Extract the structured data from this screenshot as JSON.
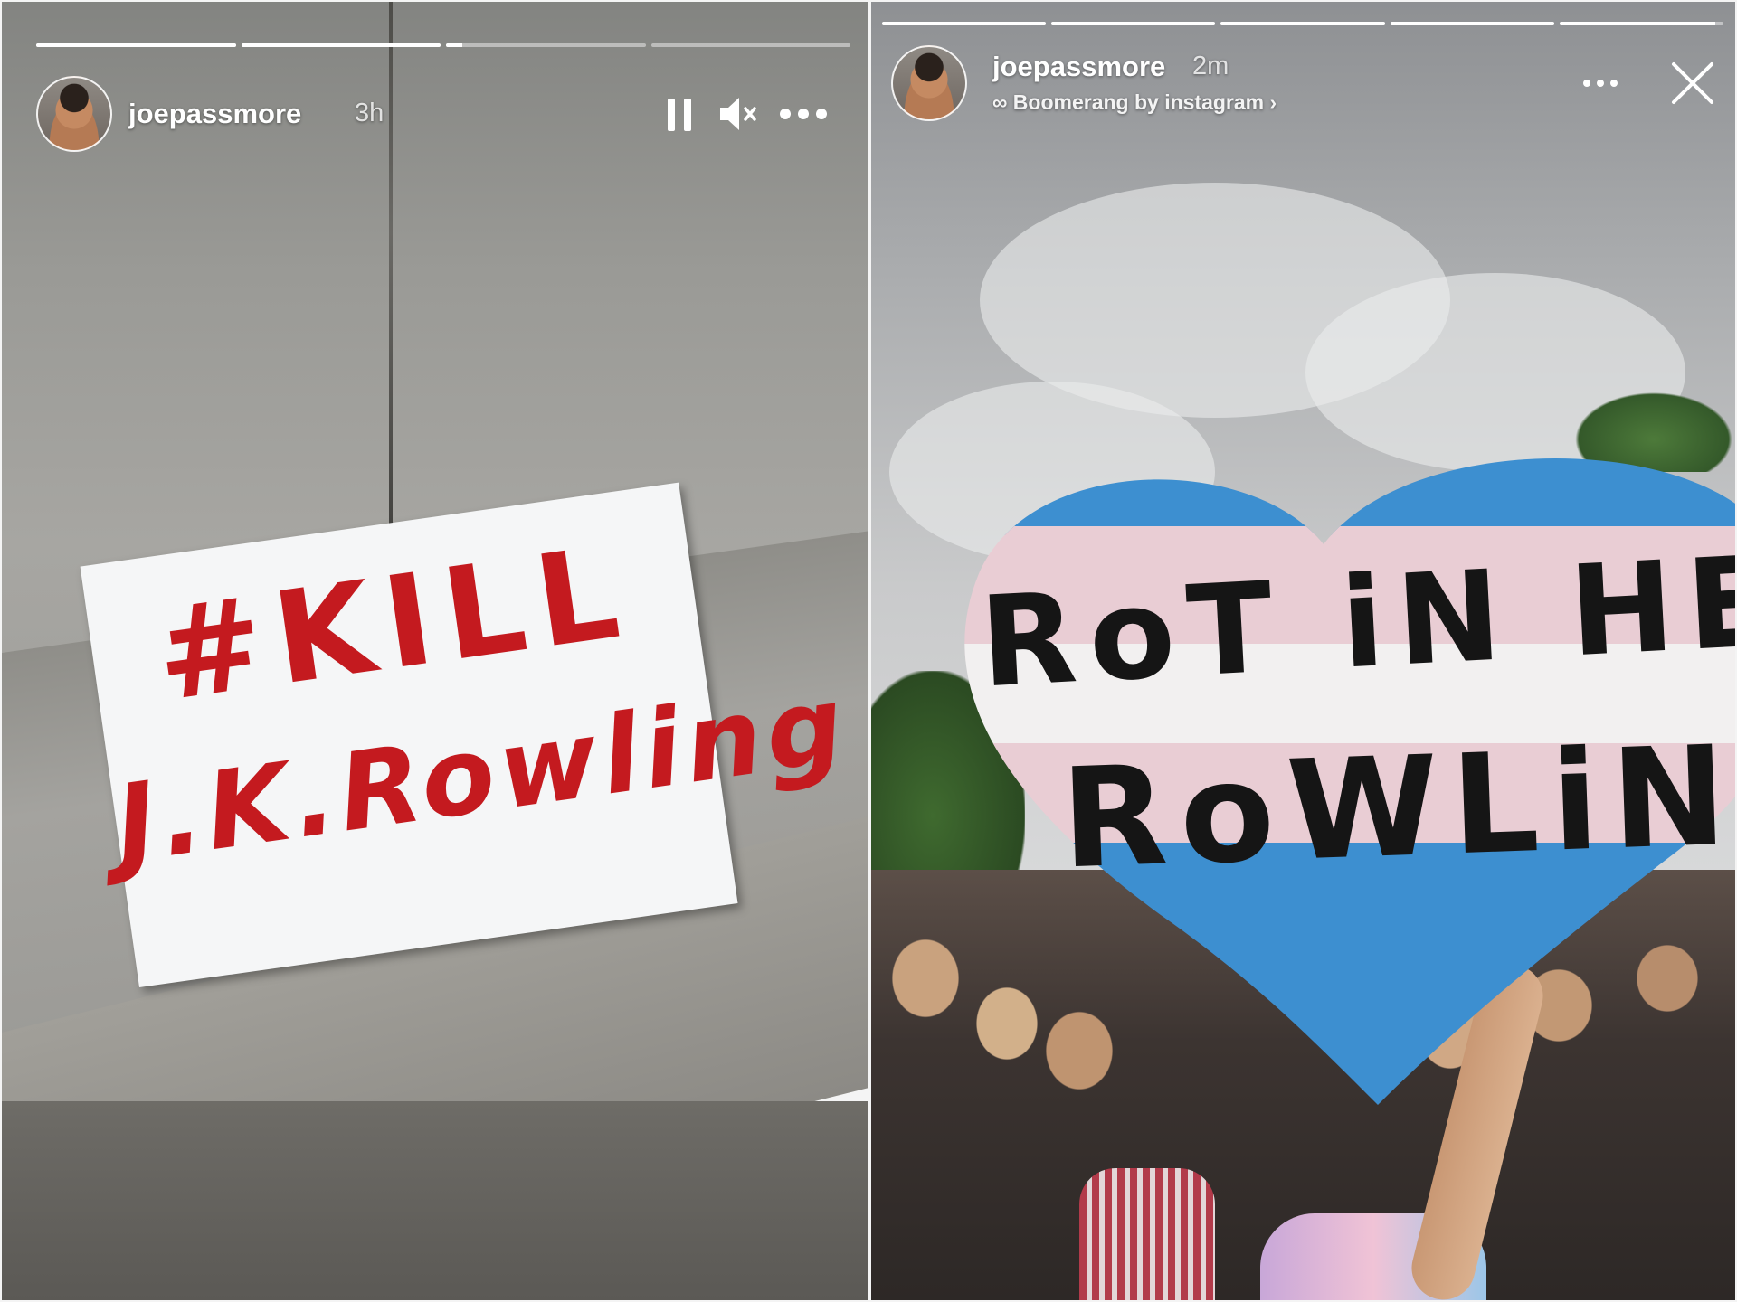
{
  "left_story": {
    "progress": [
      1.0,
      1.0,
      0.08,
      0.0
    ],
    "username": "joepassmore",
    "timestamp": "3h",
    "icons": [
      "pause-icon",
      "mute-icon",
      "more-icon"
    ],
    "sign_lines": [
      "#KILL",
      "J.K.Rowling"
    ],
    "sign_color": "#c41a1f"
  },
  "right_story": {
    "progress": [
      1.0,
      1.0,
      1.0,
      1.0,
      0.95
    ],
    "username": "joepassmore",
    "timestamp": "2m",
    "subtitle": "∞ Boomerang by instagram ›",
    "icons": [
      "more-icon",
      "close-icon"
    ],
    "sign_lines": [
      "RoT iN HELL",
      "RoWLiNG"
    ],
    "flag_colors": [
      "#3d8fd0",
      "#e9cdd4",
      "#f2f0f0"
    ]
  }
}
